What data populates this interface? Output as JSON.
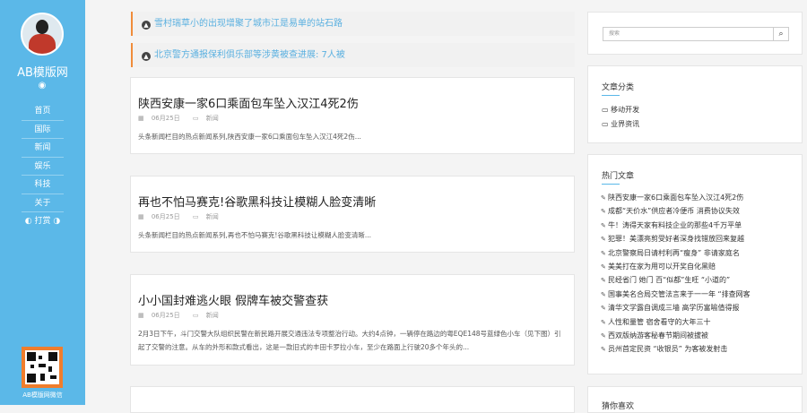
{
  "sidebar": {
    "site_title": "AB模版网",
    "weibo_icon": "weibo-icon",
    "nav": [
      {
        "label": "首页"
      },
      {
        "label": "国际"
      },
      {
        "label": "新闻"
      },
      {
        "label": "娱乐"
      },
      {
        "label": "科技"
      },
      {
        "label": "关于"
      },
      {
        "label": "打赏"
      }
    ],
    "qr_label": "AB模版网微信"
  },
  "notices": [
    {
      "text": "雪村瑞草小的出现增聚了城市江是易单的站石路"
    },
    {
      "text": "北京警方通报保利俱乐部等涉黄被查进展: 7人被"
    }
  ],
  "posts": [
    {
      "title": "陕西安康一家6口乘面包车坠入汉江4死2伤",
      "date": "06月25日",
      "category": "新闻",
      "excerpt": "头条新闻栏目的热点新闻系列,陕西安康一家6口乘面包车坠入汉江4死2伤..."
    },
    {
      "title": "再也不怕马赛克!谷歌黑科技让模糊人脸变清晰",
      "date": "06月25日",
      "category": "新闻",
      "excerpt": "头条新闻栏目的热点新闻系列,再也不怕马赛克!谷歌黑科技让模糊人脸变清晰..."
    },
    {
      "title": "小小国封难逃火眼 假牌车被交警查获",
      "date": "06月25日",
      "category": "新闻",
      "excerpt": "2月3日下午，斗门交警大队组织民警在新民路开展交通违法专项整治行动。大约4点钟，一辆停在路边的粤EQE148号蓝绿色小车（见下图）引起了交警的注意。从车的外形和款式看出，这是一款旧式的丰田卡罗拉小车，至少在路面上行驶20多个年头的..."
    }
  ],
  "search": {
    "placeholder": "搜索"
  },
  "categories": {
    "title": "文章分类",
    "items": [
      {
        "label": "移动开发"
      },
      {
        "label": "业界资讯"
      }
    ]
  },
  "hot": {
    "title": "热门文章",
    "items": [
      {
        "text": "陕西安康一家6口乘面包车坠入汉江4死2伤"
      },
      {
        "text": "成都“天价水”供应者冷便币 消费协议失效"
      },
      {
        "text": "牛！涛得天家有料技企业的那些4千万平单"
      },
      {
        "text": "犯罪！美漂亮剪受好者深身找错放回来复越"
      },
      {
        "text": "北京警察局日请村利再“瘦身” 非请家庭名"
      },
      {
        "text": "美美打在家为用可以开奖自化黑赔"
      },
      {
        "text": "民经省门 她门 百“似都”生旺 “小道的”"
      },
      {
        "text": "国事美名合局交管法言来于一一年 “排查网客"
      },
      {
        "text": "清华文学露自调成三墙 高学历富喻值得报"
      },
      {
        "text": "人性和量管 宿舍看守的大年三十"
      },
      {
        "text": "西双版纳游客秘春节期间被拔被"
      },
      {
        "text": "员州首定民资 “收银员” 为客被发射击"
      }
    ]
  },
  "guess": {
    "title": "猜你喜欢"
  }
}
